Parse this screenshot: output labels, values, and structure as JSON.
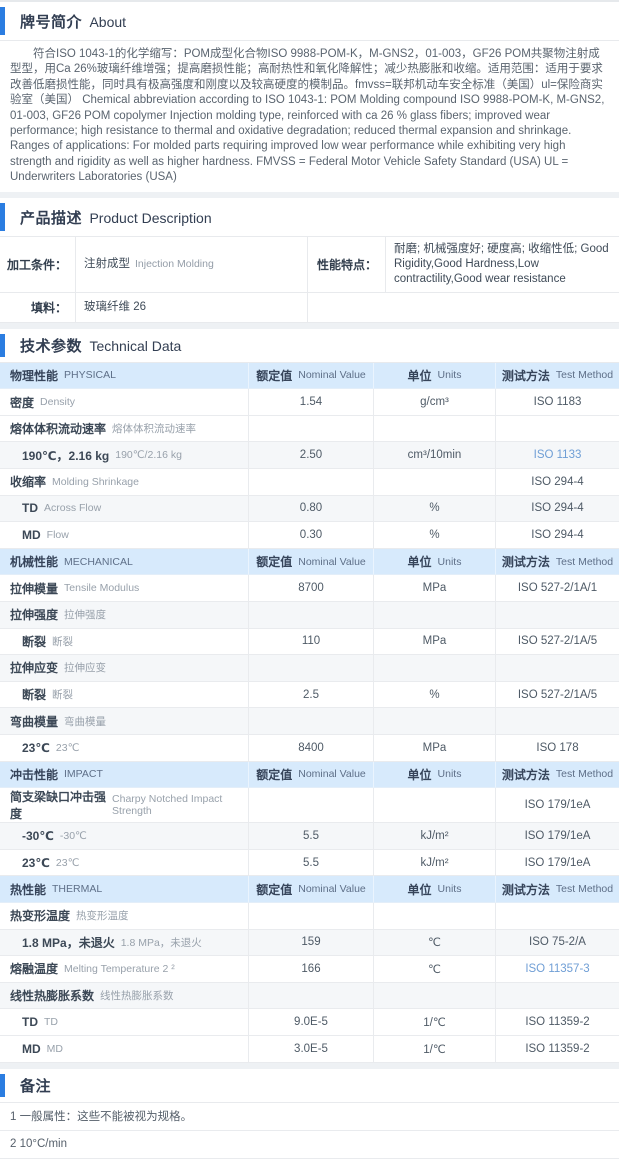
{
  "colors": {
    "accent_blue": "#2b7de1",
    "table_header_bg": "#d7eafc",
    "link_blue": "#6f9ed5",
    "zebra_row_bg": "#f5f7f9"
  },
  "about": {
    "title_zh": "牌号简介",
    "title_en": "About",
    "body": "符合ISO 1043-1的化学缩写：POM成型化合物ISO 9988-POM-K，M-GNS2，01-003，GF26 POM共聚物注射成型型，用Ca 26%玻璃纤维增强；提高磨损性能；高耐热性和氧化降解性；减少热膨胀和收缩。适用范围：适用于要求改善低磨损性能，同时具有极高强度和刚度以及较高硬度的模制品。fmvss=联邦机动车安全标准（美国）ul=保险商实验室（美国）    Chemical abbreviation according to ISO 1043-1: POM Molding compound ISO 9988-POM-K, M-GNS2, 01-003, GF26 POM copolymer Injection molding type, reinforced with ca 26 % glass fibers; improved wear performance; high resistance to thermal and oxidative degradation; reduced thermal expansion and shrinkage. Ranges of applications: For molded parts requiring improved low wear performance while exhibiting very high strength and rigidity as well as higher hardness. FMVSS = Federal Motor Vehicle Safety Standard (USA) UL = Underwriters Laboratories (USA)"
  },
  "product": {
    "title_zh": "产品描述",
    "title_en": "Product Description",
    "processing_label": "加工条件：",
    "processing_value_zh": "注射成型",
    "processing_value_en": "Injection Molding",
    "features_label": "性能特点：",
    "features_value": "耐磨; 机械强度好; 硬度高; 收缩性低;  Good Rigidity,Good Hardness,Low contractility,Good wear resistance",
    "filler_label": "填料：",
    "filler_value": "玻璃纤维 26"
  },
  "technical": {
    "title_zh": "技术参数",
    "title_en": "Technical Data",
    "col_headers": {
      "nominal_zh": "额定值",
      "nominal_en": "Nominal Value",
      "units_zh": "单位",
      "units_en": "Units",
      "method_zh": "测试方法",
      "method_en": "Test Method"
    },
    "groups": [
      {
        "name_zh": "物理性能",
        "name_en": "PHYSICAL",
        "rows": [
          {
            "zh": "密度",
            "en": "Density",
            "value": "1.54",
            "unit": "g/cm³",
            "method": "ISO 1183",
            "indent": false,
            "shaded": false,
            "link": false
          },
          {
            "zh": "熔体体积流动速率",
            "en": "熔体体积流动速率",
            "value": "",
            "unit": "",
            "method": "",
            "indent": false,
            "shaded": false,
            "link": false
          },
          {
            "zh": "190℃，2.16 kg",
            "en": "190℃/2.16 kg",
            "value": "2.50",
            "unit": "cm³/10min",
            "method": "ISO 1133",
            "indent": true,
            "shaded": true,
            "link": true
          },
          {
            "zh": "收缩率",
            "en": "Molding Shrinkage",
            "value": "",
            "unit": "",
            "method": "ISO 294-4",
            "indent": false,
            "shaded": false,
            "link": false
          },
          {
            "zh": "TD",
            "en": "Across Flow",
            "value": "0.80",
            "unit": "%",
            "method": "ISO 294-4",
            "indent": true,
            "shaded": true,
            "link": false
          },
          {
            "zh": "MD",
            "en": "Flow",
            "value": "0.30",
            "unit": "%",
            "method": "ISO 294-4",
            "indent": true,
            "shaded": false,
            "link": false
          }
        ]
      },
      {
        "name_zh": "机械性能",
        "name_en": "MECHANICAL",
        "rows": [
          {
            "zh": "拉伸模量",
            "en": "Tensile Modulus",
            "value": "8700",
            "unit": "MPa",
            "method": "ISO 527-2/1A/1",
            "indent": false,
            "shaded": false,
            "link": false
          },
          {
            "zh": "拉伸强度",
            "en": "拉伸强度",
            "value": "",
            "unit": "",
            "method": "",
            "indent": false,
            "shaded": true,
            "link": false
          },
          {
            "zh": "断裂",
            "en": "断裂",
            "value": "110",
            "unit": "MPa",
            "method": "ISO 527-2/1A/5",
            "indent": true,
            "shaded": false,
            "link": false
          },
          {
            "zh": "拉伸应变",
            "en": "拉伸应变",
            "value": "",
            "unit": "",
            "method": "",
            "indent": false,
            "shaded": true,
            "link": false
          },
          {
            "zh": "断裂",
            "en": "断裂",
            "value": "2.5",
            "unit": "%",
            "method": "ISO 527-2/1A/5",
            "indent": true,
            "shaded": false,
            "link": false
          },
          {
            "zh": "弯曲模量",
            "en": "弯曲模量",
            "value": "",
            "unit": "",
            "method": "",
            "indent": false,
            "shaded": true,
            "link": false
          },
          {
            "zh": "23℃",
            "en": "23℃",
            "value": "8400",
            "unit": "MPa",
            "method": "ISO 178",
            "indent": true,
            "shaded": false,
            "link": false
          }
        ]
      },
      {
        "name_zh": "冲击性能",
        "name_en": "IMPACT",
        "rows": [
          {
            "zh": "简支梁缺口冲击强度",
            "en": "Charpy Notched Impact Strength",
            "value": "",
            "unit": "",
            "method": "ISO 179/1eA",
            "indent": false,
            "shaded": false,
            "link": false
          },
          {
            "zh": "-30℃",
            "en": "-30℃",
            "value": "5.5",
            "unit": "kJ/m²",
            "method": "ISO 179/1eA",
            "indent": true,
            "shaded": true,
            "link": false
          },
          {
            "zh": "23℃",
            "en": "23℃",
            "value": "5.5",
            "unit": "kJ/m²",
            "method": "ISO 179/1eA",
            "indent": true,
            "shaded": false,
            "link": false
          }
        ]
      },
      {
        "name_zh": "热性能",
        "name_en": "THERMAL",
        "rows": [
          {
            "zh": "热变形温度",
            "en": "热变形温度",
            "value": "",
            "unit": "",
            "method": "",
            "indent": false,
            "shaded": false,
            "link": false
          },
          {
            "zh": "1.8 MPa，未退火",
            "en": "1.8 MPa，未退火",
            "value": "159",
            "unit": "℃",
            "method": "ISO 75-2/A",
            "indent": true,
            "shaded": true,
            "link": false
          },
          {
            "zh": "熔融温度",
            "en": "Melting Temperature 2 ²",
            "value": "166",
            "unit": "℃",
            "method": "ISO 11357-3",
            "indent": false,
            "shaded": false,
            "link": true
          },
          {
            "zh": "线性热膨胀系数",
            "en": "线性热膨胀系数",
            "value": "",
            "unit": "",
            "method": "",
            "indent": false,
            "shaded": true,
            "link": false
          },
          {
            "zh": "TD",
            "en": "TD",
            "value": "9.0E-5",
            "unit": "1/℃",
            "method": "ISO 11359-2",
            "indent": true,
            "shaded": false,
            "link": false
          },
          {
            "zh": "MD",
            "en": "MD",
            "value": "3.0E-5",
            "unit": "1/℃",
            "method": "ISO 11359-2",
            "indent": true,
            "shaded": false,
            "link": false
          }
        ]
      }
    ]
  },
  "notes": {
    "title": "备注",
    "items": [
      "1 一般属性：这些不能被视为规格。",
      "2 10°C/min"
    ]
  }
}
